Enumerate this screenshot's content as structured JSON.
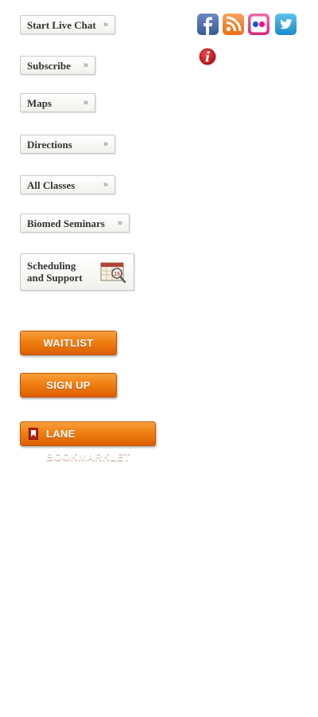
{
  "nav": {
    "live_chat": "Start Live Chat",
    "subscribe": "Subscribe",
    "maps": "Maps",
    "directions": "Directions",
    "all_classes": "All Classes",
    "biomed_seminars": "Biomed Seminars",
    "chevron": "»"
  },
  "scheduling": {
    "line1": "Scheduling",
    "line2": "and Support",
    "icon": "calendar-magnifier-icon"
  },
  "buttons": {
    "waitlist": "WAITLIST",
    "sign_up": "SIGN UP",
    "bookmarklet": "LANE BOOKMARKLET"
  },
  "social": [
    "facebook-icon",
    "rss-icon",
    "flickr-icon",
    "twitter-icon"
  ],
  "info_icon": "info-icon",
  "colors": {
    "orange_button": "#f07f12",
    "facebook": "#3b5998",
    "rss": "#f58220",
    "flickr_pink": "#ff0084",
    "flickr_blue": "#0063dc",
    "twitter": "#2a9fd6",
    "info_red": "#c8141a"
  }
}
